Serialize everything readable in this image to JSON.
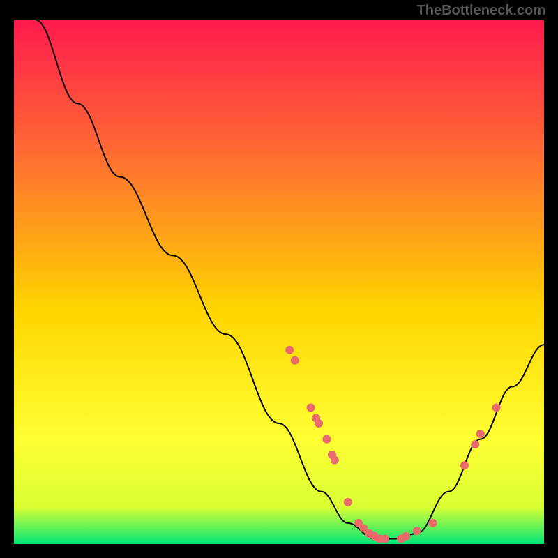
{
  "watermark": "TheBottleneck.com",
  "chart_data": {
    "type": "line",
    "title": "",
    "xlabel": "",
    "ylabel": "",
    "xlim": [
      0,
      100
    ],
    "ylim": [
      0,
      100
    ],
    "gradient": {
      "top": "#ff1a4d",
      "mid_upper": "#ff6a33",
      "mid": "#ffd400",
      "mid_lower": "#ffff33",
      "low": "#d9ff33",
      "bottom": "#00e676"
    },
    "curve": [
      {
        "x": 4,
        "y": 100
      },
      {
        "x": 12,
        "y": 84
      },
      {
        "x": 20,
        "y": 70
      },
      {
        "x": 30,
        "y": 55
      },
      {
        "x": 40,
        "y": 40
      },
      {
        "x": 50,
        "y": 23
      },
      {
        "x": 58,
        "y": 10
      },
      {
        "x": 63,
        "y": 4
      },
      {
        "x": 68,
        "y": 1
      },
      {
        "x": 72,
        "y": 1
      },
      {
        "x": 76,
        "y": 2
      },
      {
        "x": 82,
        "y": 10
      },
      {
        "x": 88,
        "y": 20
      },
      {
        "x": 94,
        "y": 30
      },
      {
        "x": 100,
        "y": 38
      }
    ],
    "markers": [
      {
        "x": 52,
        "y": 37
      },
      {
        "x": 53,
        "y": 35
      },
      {
        "x": 56,
        "y": 26
      },
      {
        "x": 57,
        "y": 24
      },
      {
        "x": 57.5,
        "y": 23
      },
      {
        "x": 59,
        "y": 20
      },
      {
        "x": 60,
        "y": 17
      },
      {
        "x": 60.5,
        "y": 16
      },
      {
        "x": 63,
        "y": 8
      },
      {
        "x": 65,
        "y": 4
      },
      {
        "x": 66,
        "y": 3
      },
      {
        "x": 67,
        "y": 2
      },
      {
        "x": 68,
        "y": 1.5
      },
      {
        "x": 69,
        "y": 1
      },
      {
        "x": 70,
        "y": 1
      },
      {
        "x": 73,
        "y": 1
      },
      {
        "x": 74,
        "y": 1.5
      },
      {
        "x": 76,
        "y": 2.5
      },
      {
        "x": 79,
        "y": 4
      },
      {
        "x": 85,
        "y": 15
      },
      {
        "x": 87,
        "y": 19
      },
      {
        "x": 88,
        "y": 21
      },
      {
        "x": 91,
        "y": 26
      }
    ]
  }
}
